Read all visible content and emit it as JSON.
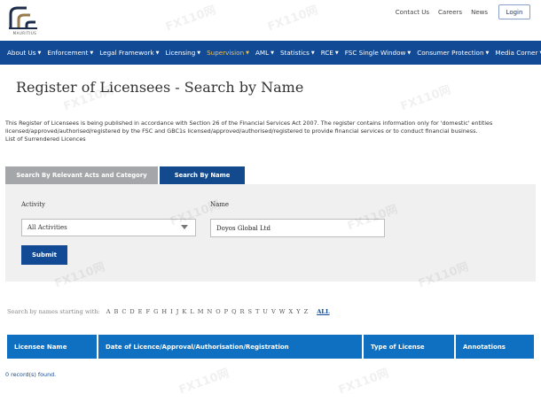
{
  "header": {
    "logo_text": "MAURITIUS",
    "links": [
      "Contact Us",
      "Careers",
      "News"
    ],
    "login_label": "Login"
  },
  "nav": {
    "items": [
      {
        "label": "About Us",
        "active": false
      },
      {
        "label": "Enforcement",
        "active": false
      },
      {
        "label": "Legal Framework",
        "active": false
      },
      {
        "label": "Licensing",
        "active": false
      },
      {
        "label": "Supervision",
        "active": true
      },
      {
        "label": "AML",
        "active": false
      },
      {
        "label": "Statistics",
        "active": false
      },
      {
        "label": "RCE",
        "active": false
      },
      {
        "label": "FSC Single Window",
        "active": false
      },
      {
        "label": "Consumer Protection",
        "active": false
      },
      {
        "label": "Media Corner",
        "active": false
      }
    ]
  },
  "page": {
    "title": "Register of Licensees - Search by Name",
    "intro_line1": "This Register of Licensees is being published in accordance with Section 26 of the Financial Services Act 2007. The register contains information only for 'domestic' entities",
    "intro_line2": "licensed/approved/authorised/registered by the FSC and GBC1s licensed/approved/authorised/registered to provide financial services or to conduct financial business.",
    "intro_line3": "List of Surrendered Licences"
  },
  "tabs": [
    {
      "label": "Search By Relevant Acts and Category",
      "active": false
    },
    {
      "label": "Search By Name",
      "active": true
    }
  ],
  "search": {
    "activity_label": "Activity",
    "activity_value": "All Activities",
    "name_label": "Name",
    "name_value": "Doyos Global Ltd",
    "submit_label": "Submit"
  },
  "alphabet": {
    "label": "Search by names starting with:",
    "letters": [
      "A",
      "B",
      "C",
      "D",
      "E",
      "F",
      "G",
      "H",
      "I",
      "J",
      "K",
      "L",
      "M",
      "N",
      "O",
      "P",
      "Q",
      "R",
      "S",
      "T",
      "U",
      "V",
      "W",
      "X",
      "Y",
      "Z"
    ],
    "all_label": "ALL"
  },
  "results": {
    "columns": [
      "Licensee Name",
      "Date of Licence/Approval/Authorisation/Registration",
      "Type of License",
      "Annotations"
    ],
    "rows": [],
    "count_text": "0 record(s) found."
  },
  "watermark": {
    "text": "FX110网"
  },
  "colors": {
    "nav_bg": "#124a95",
    "active_nav": "#f2c14e",
    "tab_inactive": "#a4a6a9",
    "tab_active": "#134a8e",
    "table_header": "#0f6fc0",
    "panel_bg": "#f0f0f0"
  }
}
